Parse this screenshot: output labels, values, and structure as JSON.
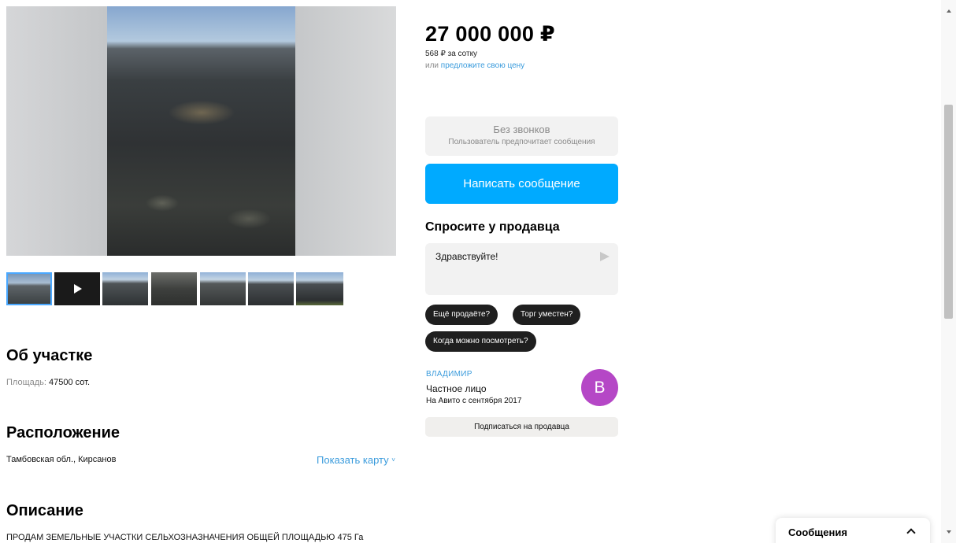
{
  "listing": {
    "price": "27 000 000 ₽",
    "price_per_unit": "568 ₽ за сотку",
    "offer_prefix": "или ",
    "offer_link": "предложите свою цену"
  },
  "contact": {
    "no_calls_title": "Без звонков",
    "no_calls_subtitle": "Пользователь предпочитает сообщения",
    "write_button": "Написать сообщение"
  },
  "ask": {
    "title": "Спросите у продавца",
    "message_value": "Здравствуйте!",
    "quick_replies": [
      "Ещё продаёте?",
      "Торг уместен?",
      "Когда можно посмотреть?"
    ]
  },
  "seller": {
    "name": "ВЛАДИМИР",
    "type": "Частное лицо",
    "since": "На Авито с сентября 2017",
    "avatar_letter": "В",
    "avatar_color": "#b547c6",
    "subscribe_button": "Подписаться на продавца"
  },
  "about": {
    "title": "Об участке",
    "area_label": "Площадь: ",
    "area_value": "47500 сот."
  },
  "location": {
    "title": "Расположение",
    "address": "Тамбовская обл., Кирсанов",
    "map_link": "Показать карту",
    "map_link_icon": "chevron-down-icon"
  },
  "description": {
    "title": "Описание",
    "text": "ПРОДАМ ЗЕМЕЛЬНЫЕ УЧАСТКИ СЕЛЬХОЗНАЗНАЧЕНИЯ ОБЩЕЙ ПЛОЩАДЬЮ 475 Га"
  },
  "messages_widget": {
    "label": "Сообщения"
  },
  "colors": {
    "accent": "#00aaff",
    "link": "#3a9bdc"
  }
}
